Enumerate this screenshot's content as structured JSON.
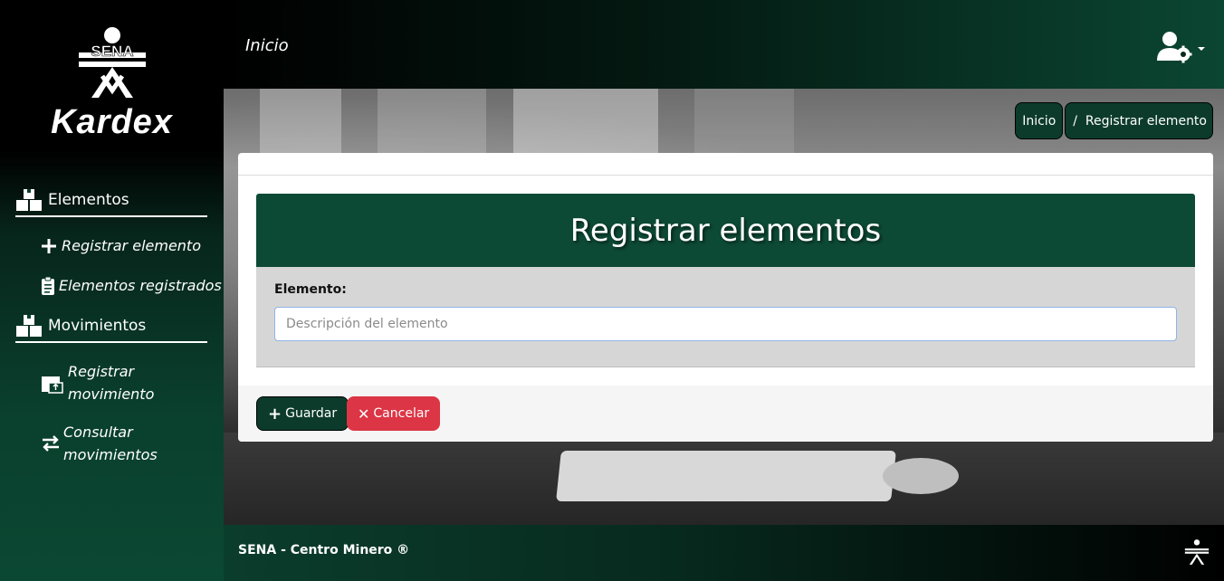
{
  "sidebar": {
    "brand": "Kardex",
    "logo_text": "SENA",
    "sections": [
      {
        "label": "Elementos"
      },
      {
        "label": "Movimientos"
      }
    ],
    "items": [
      {
        "label": "Registrar elemento"
      },
      {
        "label": "Elementos registrados"
      },
      {
        "label": "Registrar movimiento"
      },
      {
        "label": "Consultar movimientos"
      }
    ]
  },
  "topbar": {
    "title": "Inicio"
  },
  "breadcrumb": [
    "Inicio",
    "/  Registrar elemento"
  ],
  "form": {
    "title": "Registrar elementos",
    "field_label": "Elemento:",
    "field_placeholder": "Descripción del elemento",
    "field_value": "",
    "save_label": "Guardar",
    "cancel_label": "Cancelar"
  },
  "footer": {
    "text": "SENA - Centro Minero ®"
  },
  "colors": {
    "primary": "#0c3b2b",
    "header_green": "#0d4a35",
    "danger": "#dc3545"
  }
}
